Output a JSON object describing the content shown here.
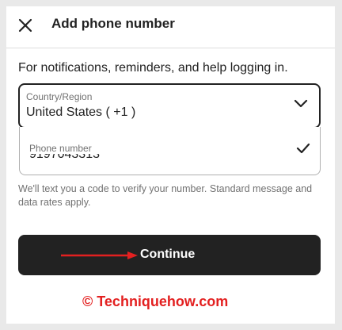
{
  "dialog": {
    "title": "Add phone number",
    "close_icon": "close-icon",
    "info_text": "For notifications, reminders, and help logging in.",
    "country": {
      "label": "Country/Region",
      "value": "United States ( +1 )",
      "icon": "chevron-down-icon"
    },
    "phone": {
      "label": "Phone number",
      "value": "9197043313",
      "icon": "check-icon"
    },
    "disclaimer": "We'll text you a code to verify your number. Standard message and data rates apply.",
    "continue_label": "Continue",
    "colors": {
      "button_bg": "#222222",
      "button_text": "#ffffff",
      "annotation": "#e32020"
    }
  },
  "annotation": {
    "arrow_icon": "right-arrow-icon",
    "watermark": "© Techniquehow.com"
  }
}
